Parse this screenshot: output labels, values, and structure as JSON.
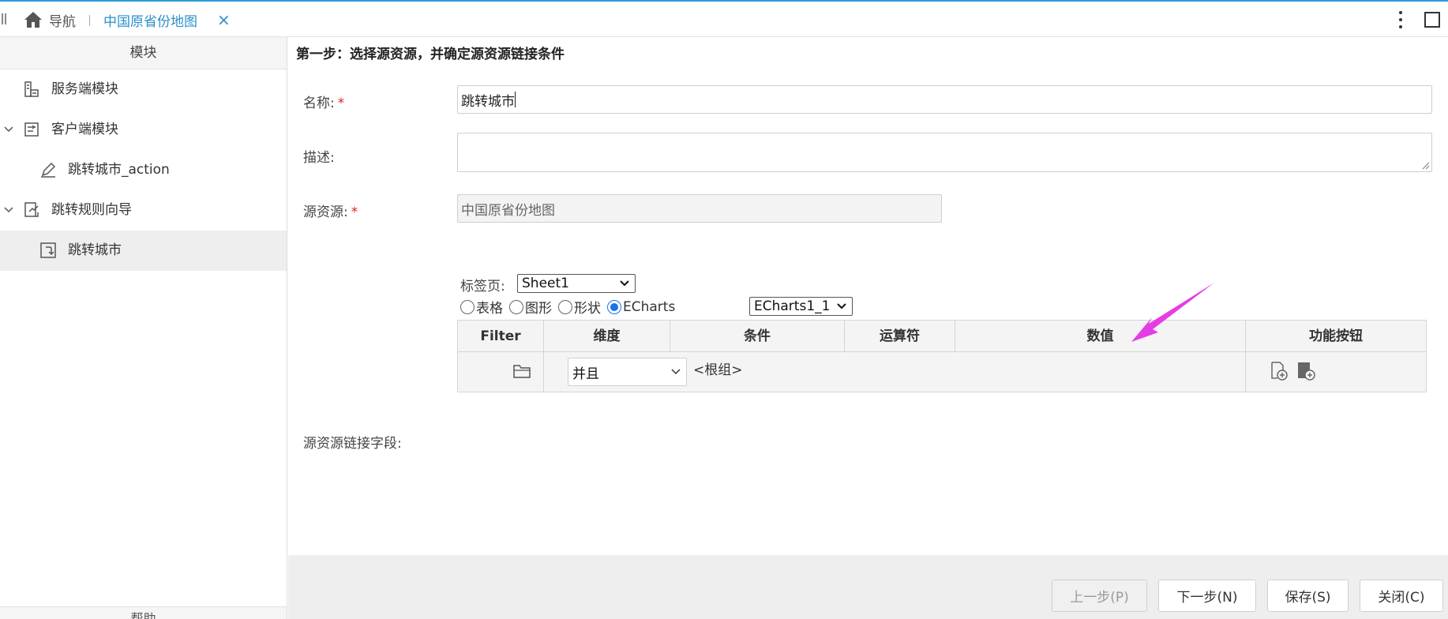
{
  "tabs": {
    "home_label": "导航",
    "active_label": "中国原省份地图",
    "close_glyph": "×"
  },
  "sidebar": {
    "header": "模块",
    "items": [
      {
        "label": "服务端模块",
        "icon": "server-module-icon"
      },
      {
        "label": "客户端模块",
        "icon": "client-module-icon"
      },
      {
        "label": "跳转城市_action",
        "icon": "pen-edit-icon"
      },
      {
        "label": "跳转规则向导",
        "icon": "jump-rule-wizard-icon"
      },
      {
        "label": "跳转城市",
        "icon": "jump-link-icon"
      }
    ],
    "footer": "帮助"
  },
  "form": {
    "step_title": "第一步：选择源资源，并确定源资源链接条件",
    "name_label": "名称:",
    "name_value": "跳转城市",
    "desc_label": "描述:",
    "desc_value": "",
    "source_label": "源资源:",
    "source_value": "中国原省份地图",
    "required_mark": "*",
    "link_field_label": "源资源链接字段:",
    "sheet_label": "标签页:",
    "sheet_value": "Sheet1",
    "radios": [
      {
        "label": "表格",
        "checked": false
      },
      {
        "label": "图形",
        "checked": false
      },
      {
        "label": "形状",
        "checked": false
      },
      {
        "label": "ECharts",
        "checked": true
      }
    ],
    "echarts_value": "ECharts1_1"
  },
  "grid": {
    "columns": [
      "Filter",
      "维度",
      "条件",
      "运算符",
      "数值",
      "功能按钮"
    ],
    "row": {
      "logic_value": "并且",
      "group_text": "<根组>"
    }
  },
  "buttons": {
    "prev": "上一步(P)",
    "next": "下一步(N)",
    "save": "保存(S)",
    "close": "关闭(C)"
  },
  "colors": {
    "accent": "#2b8fc9",
    "annotation_arrow": "#e63ce6"
  }
}
